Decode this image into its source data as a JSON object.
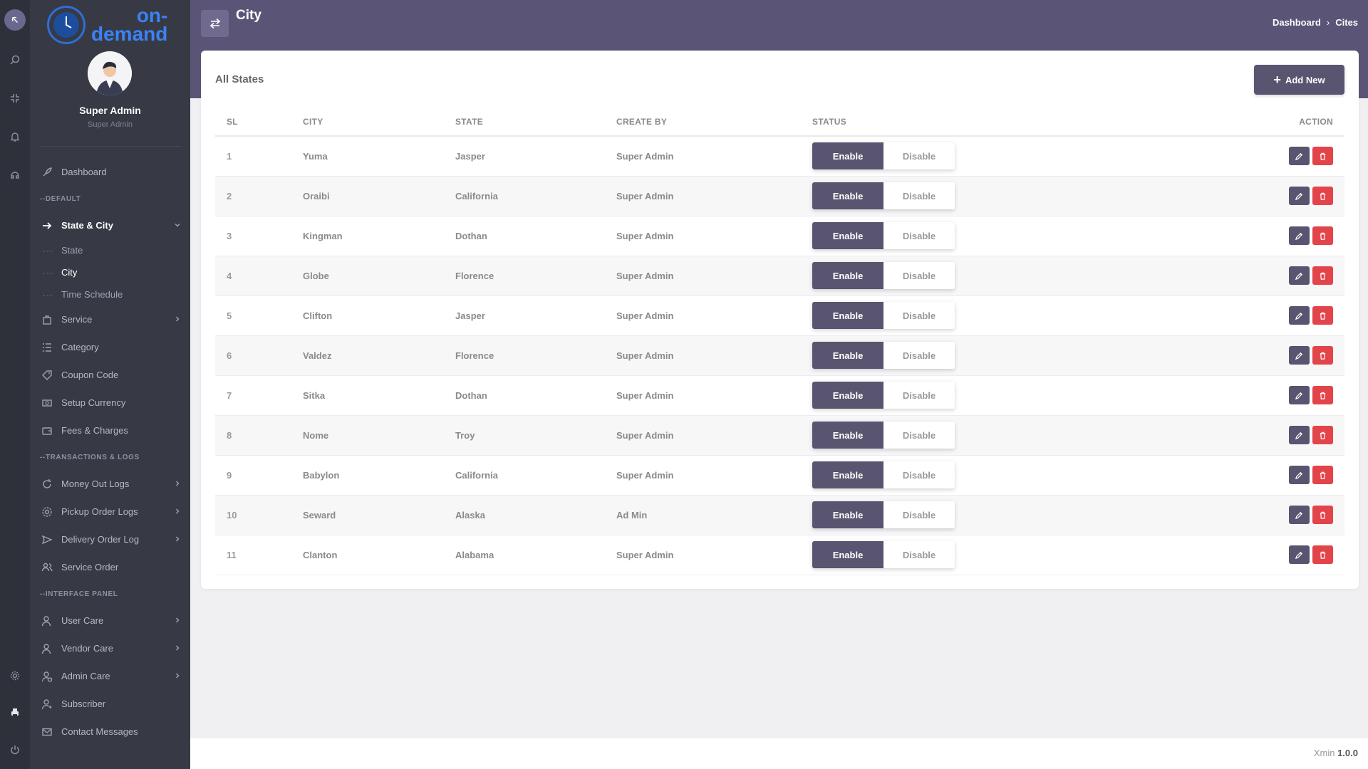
{
  "brand": {
    "line1": "on-",
    "line2": "demand"
  },
  "profile": {
    "name": "Super Admin",
    "role": "Super Admin"
  },
  "nav": {
    "dashboard": "Dashboard",
    "section_default": "--DEFAULT",
    "state_city": "State & City",
    "state": "State",
    "city": "City",
    "time_schedule": "Time Schedule",
    "service": "Service",
    "category": "Category",
    "coupon_code": "Coupon Code",
    "setup_currency": "Setup Currency",
    "fees_charges": "Fees & Charges",
    "section_transactions": "--TRANSACTIONS & LOGS",
    "money_out_logs": "Money Out Logs",
    "pickup_order_logs": "Pickup Order Logs",
    "delivery_order_log": "Delivery Order Log",
    "service_order": "Service Order",
    "section_interface": "--INTERFACE PANEL",
    "user_care": "User Care",
    "vendor_care": "Vendor Care",
    "admin_care": "Admin Care",
    "subscriber": "Subscriber",
    "contact_messages": "Contact Messages"
  },
  "header": {
    "title": "City",
    "breadcrumb": [
      "Dashboard",
      "Cites"
    ]
  },
  "card": {
    "title": "All States",
    "add_label": "Add New"
  },
  "table": {
    "columns": {
      "sl": "SL",
      "city": "CITY",
      "state": "STATE",
      "create_by": "CREATE BY",
      "status": "STATUS",
      "action": "ACTION"
    },
    "enable_label": "Enable",
    "disable_label": "Disable",
    "rows": [
      {
        "sl": "1",
        "city": "Yuma",
        "state": "Jasper",
        "create_by": "Super Admin"
      },
      {
        "sl": "2",
        "city": "Oraibi",
        "state": "California",
        "create_by": "Super Admin"
      },
      {
        "sl": "3",
        "city": "Kingman",
        "state": "Dothan",
        "create_by": "Super Admin"
      },
      {
        "sl": "4",
        "city": "Globe",
        "state": "Florence",
        "create_by": "Super Admin"
      },
      {
        "sl": "5",
        "city": "Clifton",
        "state": "Jasper",
        "create_by": "Super Admin"
      },
      {
        "sl": "6",
        "city": "Valdez",
        "state": "Florence",
        "create_by": "Super Admin"
      },
      {
        "sl": "7",
        "city": "Sitka",
        "state": "Dothan",
        "create_by": "Super Admin"
      },
      {
        "sl": "8",
        "city": "Nome",
        "state": "Troy",
        "create_by": "Super Admin"
      },
      {
        "sl": "9",
        "city": "Babylon",
        "state": "California",
        "create_by": "Super Admin"
      },
      {
        "sl": "10",
        "city": "Seward",
        "state": "Alaska",
        "create_by": "Ad Min"
      },
      {
        "sl": "11",
        "city": "Clanton",
        "state": "Alabama",
        "create_by": "Super Admin"
      }
    ]
  },
  "footer": {
    "product": "Xmin",
    "version": "1.0.0"
  },
  "colors": {
    "primary": "#59546f",
    "header_bg": "#5a5577",
    "sidebar_bg": "#373a44",
    "rail_bg": "#2e3139",
    "danger": "#e3444a",
    "brand_blue": "#3b82f6"
  }
}
